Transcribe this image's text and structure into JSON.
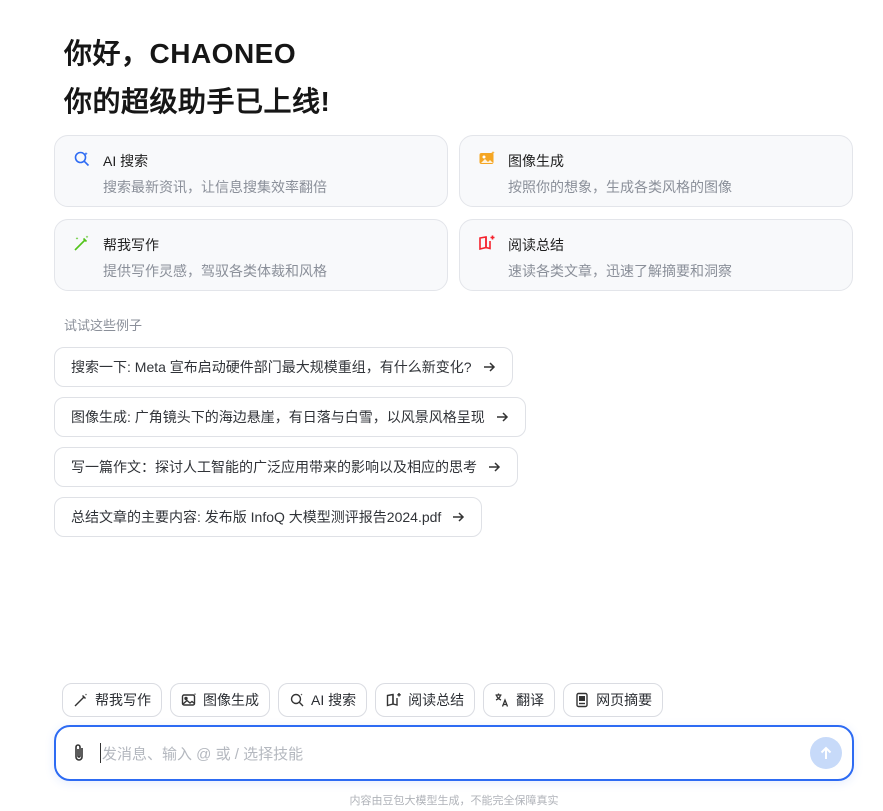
{
  "greeting": {
    "line1": "你好，CHAONEO",
    "line2": "你的超级助手已上线!"
  },
  "cards": [
    {
      "icon": "ai-search-icon",
      "title": "AI 搜索",
      "desc": "搜索最新资讯，让信息搜集效率翻倍",
      "color": "#2d6bf3"
    },
    {
      "icon": "image-generate-icon",
      "title": "图像生成",
      "desc": "按照你的想象，生成各类风格的图像",
      "color": "#f5a623"
    },
    {
      "icon": "writing-wand-icon",
      "title": "帮我写作",
      "desc": "提供写作灵感，驾驭各类体裁和风格",
      "color": "#52c41a"
    },
    {
      "icon": "reading-book-icon",
      "title": "阅读总结",
      "desc": "速读各类文章，迅速了解摘要和洞察",
      "color": "#f5222d"
    }
  ],
  "examples": {
    "label": "试试这些例子",
    "items": [
      "搜索一下: Meta 宣布启动硬件部门最大规模重组，有什么新变化?",
      "图像生成: 广角镜头下的海边悬崖，有日落与白雪，以风景风格呈现",
      "写一篇作文：探讨人工智能的广泛应用带来的影响以及相应的思考",
      "总结文章的主要内容: 发布版 InfoQ 大模型测评报告2024.pdf"
    ]
  },
  "skills": [
    {
      "icon": "writing-wand-icon",
      "label": "帮我写作"
    },
    {
      "icon": "image-icon",
      "label": "图像生成"
    },
    {
      "icon": "ai-search-icon",
      "label": "AI 搜索"
    },
    {
      "icon": "reading-book-icon",
      "label": "阅读总结"
    },
    {
      "icon": "translate-icon",
      "label": "翻译"
    },
    {
      "icon": "webpage-summary-icon",
      "label": "网页摘要"
    }
  ],
  "composer": {
    "placeholder": "发消息、输入 @ 或 / 选择技能",
    "accent": "#2d6bf3"
  },
  "footer": {
    "disclaimer": "内容由豆包大模型生成，不能完全保障真实"
  }
}
